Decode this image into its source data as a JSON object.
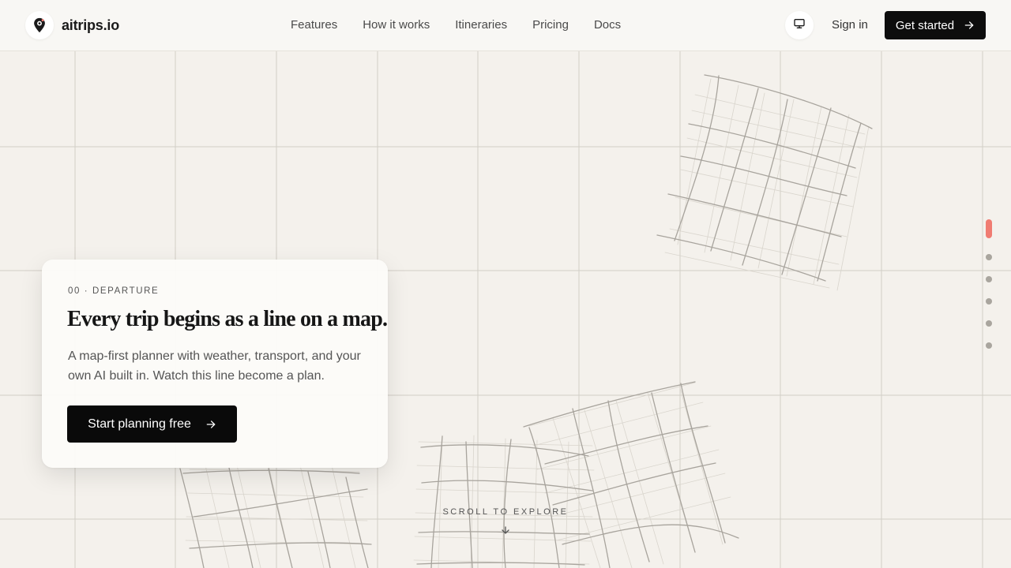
{
  "brand": {
    "name": "aitrips.io"
  },
  "nav": {
    "items": [
      "Features",
      "How it works",
      "Itineraries",
      "Pricing",
      "Docs"
    ]
  },
  "header": {
    "theme_icon": "monitor-icon",
    "signin_label": "Sign in",
    "get_started_label": "Get started"
  },
  "hero": {
    "eyebrow": "00 · DEPARTURE",
    "headline": "Every trip begins as a line on a map.",
    "description": "A map-first planner with weather, transport, and your own AI built in. Watch this line become a plan.",
    "cta_label": "Start planning free"
  },
  "section_indicator": {
    "count": 6,
    "active_index": 0,
    "active_color": "#f07c72"
  },
  "scroll_hint": {
    "label": "SCROLL TO EXPLORE",
    "icon": "chevron-down-icon"
  },
  "colors": {
    "background": "#f4f1ec",
    "accent": "#f07c72",
    "primary_button": "#0a0a0a"
  }
}
